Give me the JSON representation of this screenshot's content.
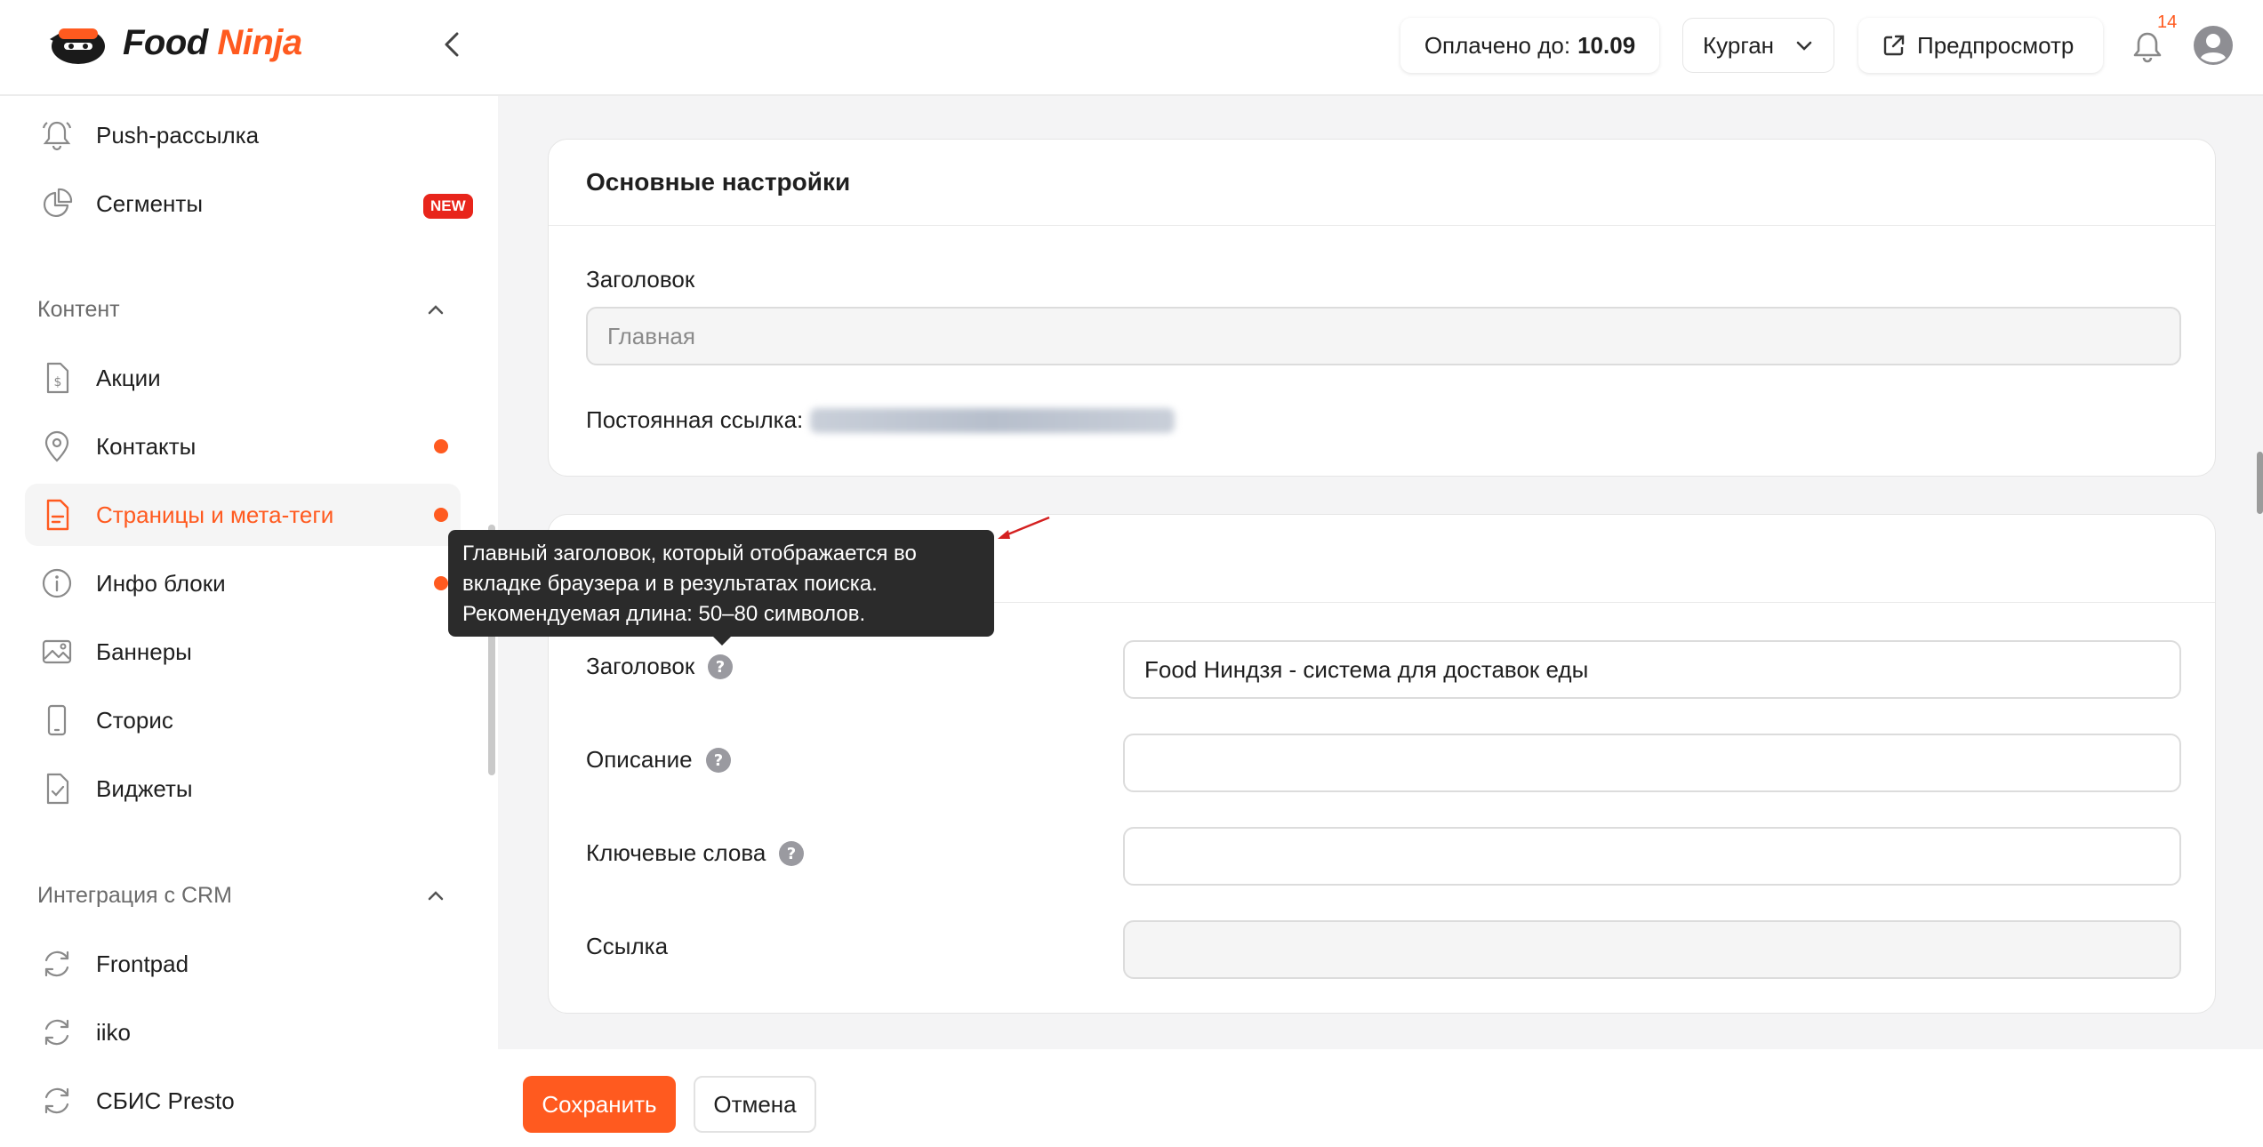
{
  "header": {
    "logo_word1": "Food",
    "logo_word2": "Ninja",
    "paid_label": "Оплачено до:",
    "paid_date": "10.09",
    "city": "Курган",
    "preview_label": "Предпросмотр",
    "notification_count": "14"
  },
  "sidebar": {
    "top_items": [
      {
        "label": "Push-рассылка",
        "icon": "bell-icon"
      },
      {
        "label": "Сегменты",
        "icon": "pie-chart-icon",
        "badge": "NEW"
      }
    ],
    "content_section": {
      "title": "Контент",
      "items": [
        {
          "label": "Акции",
          "icon": "dollar-document-icon"
        },
        {
          "label": "Контакты",
          "icon": "location-pin-icon"
        },
        {
          "label": "Страницы и мета-теги",
          "icon": "page-icon",
          "active": true
        },
        {
          "label": "Инфо блоки",
          "icon": "info-icon"
        },
        {
          "label": "Баннеры",
          "icon": "image-icon"
        },
        {
          "label": "Сторис",
          "icon": "phone-icon"
        },
        {
          "label": "Виджеты",
          "icon": "check-document-icon"
        }
      ]
    },
    "crm_section": {
      "title": "Интеграция с CRM",
      "items": [
        {
          "label": "Frontpad",
          "icon": "sync-icon"
        },
        {
          "label": "iiko",
          "icon": "sync-icon"
        },
        {
          "label": "СБИС Presto",
          "icon": "sync-icon"
        }
      ]
    }
  },
  "main_settings": {
    "title": "Основные настройки",
    "heading_label": "Заголовок",
    "heading_placeholder": "Главная",
    "permalink_label": "Постоянная ссылка:"
  },
  "seo": {
    "fields": [
      {
        "label": "Заголовок",
        "value": "Food Ниндзя - система для доставок еды",
        "help": true
      },
      {
        "label": "Описание",
        "value": "",
        "help": true
      },
      {
        "label": "Ключевые слова",
        "value": "",
        "help": true
      },
      {
        "label": "Ссылка",
        "value": "",
        "help": false
      }
    ],
    "tooltip_lines": [
      "Главный заголовок, который отображается во",
      "вкладке браузера и в результатах поиска.",
      "Рекомендуемая длина: 50–80 символов."
    ]
  },
  "footer": {
    "save_label": "Сохранить",
    "cancel_label": "Отмена"
  },
  "colors": {
    "accent": "#ff5a1f",
    "badge_red": "#e8251b",
    "tooltip_bg": "#2b2b2b"
  }
}
